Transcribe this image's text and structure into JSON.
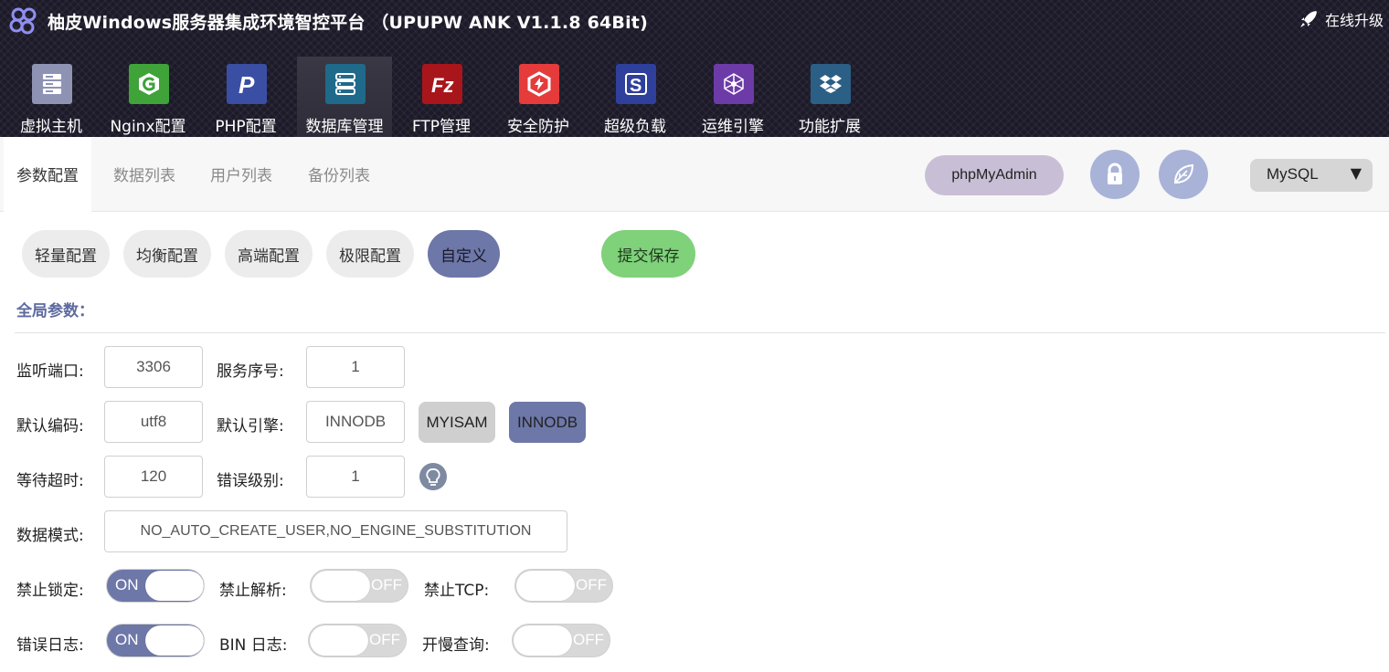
{
  "header": {
    "title": "柚皮Windows服务器集成环境智控平台 （UPUPW ANK V1.1.8 64Bit)",
    "upgrade_label": "在线升级"
  },
  "nav": [
    {
      "label": "虚拟主机",
      "icon": "server-icon",
      "color": "#8e93b4"
    },
    {
      "label": "Nginx配置",
      "icon": "nginx-icon",
      "color": "#3fa33a"
    },
    {
      "label": "PHP配置",
      "icon": "php-icon",
      "color": "#3a4fa3"
    },
    {
      "label": "数据库管理",
      "icon": "database-icon",
      "color": "#1f6a8a",
      "active": true
    },
    {
      "label": "FTP管理",
      "icon": "filezilla-icon",
      "color": "#a8161b"
    },
    {
      "label": "安全防护",
      "icon": "shield-icon",
      "color": "#e53b3b"
    },
    {
      "label": "超级负载",
      "icon": "load-icon",
      "color": "#2f3f9c"
    },
    {
      "label": "运维引擎",
      "icon": "network-icon",
      "color": "#6d3ba8"
    },
    {
      "label": "功能扩展",
      "icon": "dropbox-icon",
      "color": "#2b5f86"
    }
  ],
  "tabs": [
    "参数配置",
    "数据列表",
    "用户列表",
    "备份列表"
  ],
  "toolbar": {
    "pma_label": "phpMyAdmin",
    "lock_icon": "lock-icon",
    "leaf_icon": "leaf-icon",
    "db_select": "MySQL",
    "select_arrow": "▼"
  },
  "presets": [
    "轻量配置",
    "均衡配置",
    "高端配置",
    "极限配置",
    "自定义"
  ],
  "selected_preset": "自定义",
  "save_label": "提交保存",
  "section_title": "全局参数：",
  "form": {
    "port_label": "监听端口:",
    "port_value": "3306",
    "server_id_label": "服务序号:",
    "server_id_value": "1",
    "charset_label": "默认编码:",
    "charset_value": "utf8",
    "engine_label": "默认引擎:",
    "engine_value": "INNODB",
    "engine_opt1": "MYISAM",
    "engine_opt2": "INNODB",
    "timeout_label": "等待超时:",
    "timeout_value": "120",
    "errlevel_label": "错误级别:",
    "errlevel_value": "1",
    "sqlmode_label": "数据模式:",
    "sqlmode_value": "NO_AUTO_CREATE_USER,NO_ENGINE_SUBSTITUTION"
  },
  "toggles": [
    {
      "label": "禁止锁定:",
      "state": "ON"
    },
    {
      "label": "禁止解析:",
      "state": "OFF"
    },
    {
      "label": "禁止TCP:",
      "state": "OFF"
    },
    {
      "label": "错误日志:",
      "state": "ON"
    },
    {
      "label": "BIN 日志:",
      "state": "OFF"
    },
    {
      "label": "开慢查询:",
      "state": "OFF"
    }
  ]
}
